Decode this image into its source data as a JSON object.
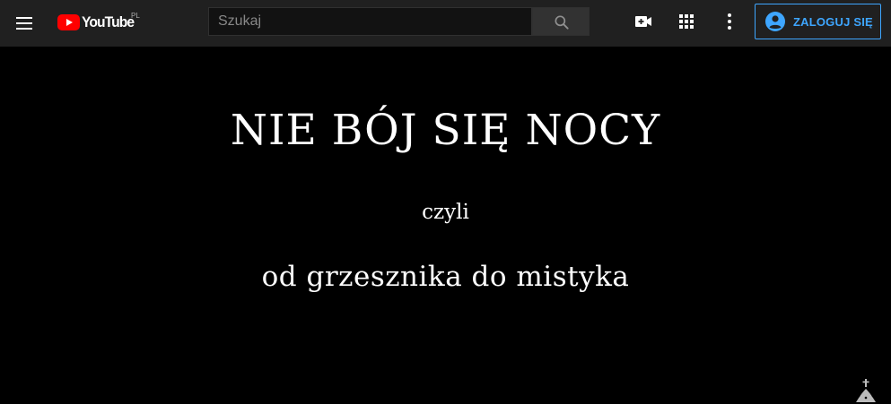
{
  "header": {
    "logo_text": "YouTube",
    "logo_country": "PL",
    "search": {
      "placeholder": "Szukaj",
      "value": ""
    },
    "login_label": "ZALOGUJ SIĘ"
  },
  "icons": {
    "menu": "menu-icon",
    "search": "search-icon",
    "create_video": "video-camera-add-icon",
    "apps": "apps-grid-icon",
    "more": "more-vertical-icon",
    "account": "account-circle-icon",
    "watermark": "cross-monastery-logo"
  },
  "video": {
    "title": "NIE BÓJ SIĘ NOCY",
    "subtitle": "czyli",
    "subtitle2": "od grzesznika do mistyka"
  },
  "colors": {
    "masthead_bg": "#202020",
    "video_bg": "#000000",
    "brand_red": "#ff0000",
    "accent_blue": "#3ea6ff",
    "text_white": "#ffffff"
  }
}
